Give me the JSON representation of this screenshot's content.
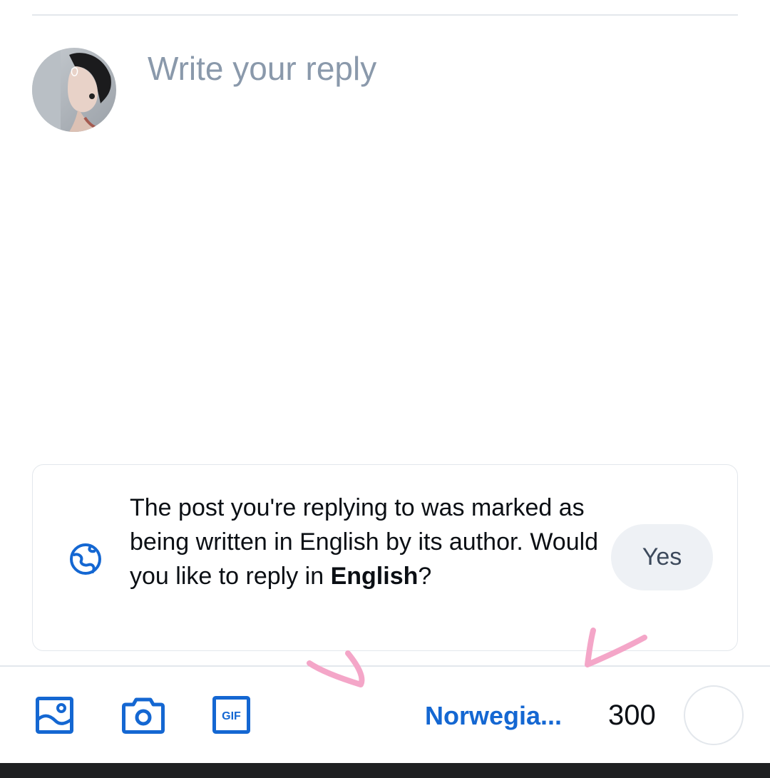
{
  "composer": {
    "placeholder": "Write your reply",
    "avatar_alt": "user-avatar"
  },
  "language_prompt": {
    "text_before": "The post you're replying to was marked as being written in English by its author. Would you like to reply in ",
    "language": "English",
    "text_after": "?",
    "yes_label": "Yes",
    "icon": "globe-icon"
  },
  "toolbar": {
    "image_icon": "image-icon",
    "camera_icon": "camera-icon",
    "gif_icon": "gif-icon",
    "gif_label": "GIF",
    "language_label": "Norwegia...",
    "char_remaining": "300",
    "char_progress": 0
  },
  "colors": {
    "accent": "#1467d2",
    "placeholder": "#8a99ab",
    "annotation": "#f4a6c8"
  }
}
